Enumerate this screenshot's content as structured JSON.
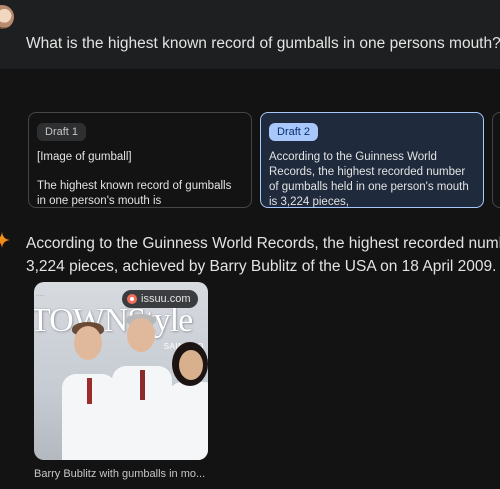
{
  "query": {
    "text": "What is the highest known record of gumballs in one persons mouth?"
  },
  "drafts": [
    {
      "label": "Draft 1",
      "line1": "[Image of gumball]",
      "line2": "The highest known record of gumballs in one person's mouth is"
    },
    {
      "label": "Draft 2",
      "text": "According to the Guinness World Records, the highest recorded number of gumballs held in one person's mouth is 3,224 pieces,"
    }
  ],
  "answer": {
    "line1": "According to the Guinness World Records, the highest recorded number of",
    "line2": "3,224 pieces, achieved by Barry Bublitz of the USA on 18 April 2009."
  },
  "image_card": {
    "source": "issuu.com",
    "magazine_title": "TOWNStyle",
    "magazine_sub": "SAINT LO",
    "caption": "Barry Bublitz with gumballs in mo..."
  },
  "colors": {
    "background": "#131314",
    "surface": "#1e1f20",
    "accent": "#a8c7fa",
    "selected_card": "#1f2a3c"
  },
  "icons": {
    "sparkle": "gemini-sparkle-icon",
    "source": "issuu-logo-icon"
  }
}
